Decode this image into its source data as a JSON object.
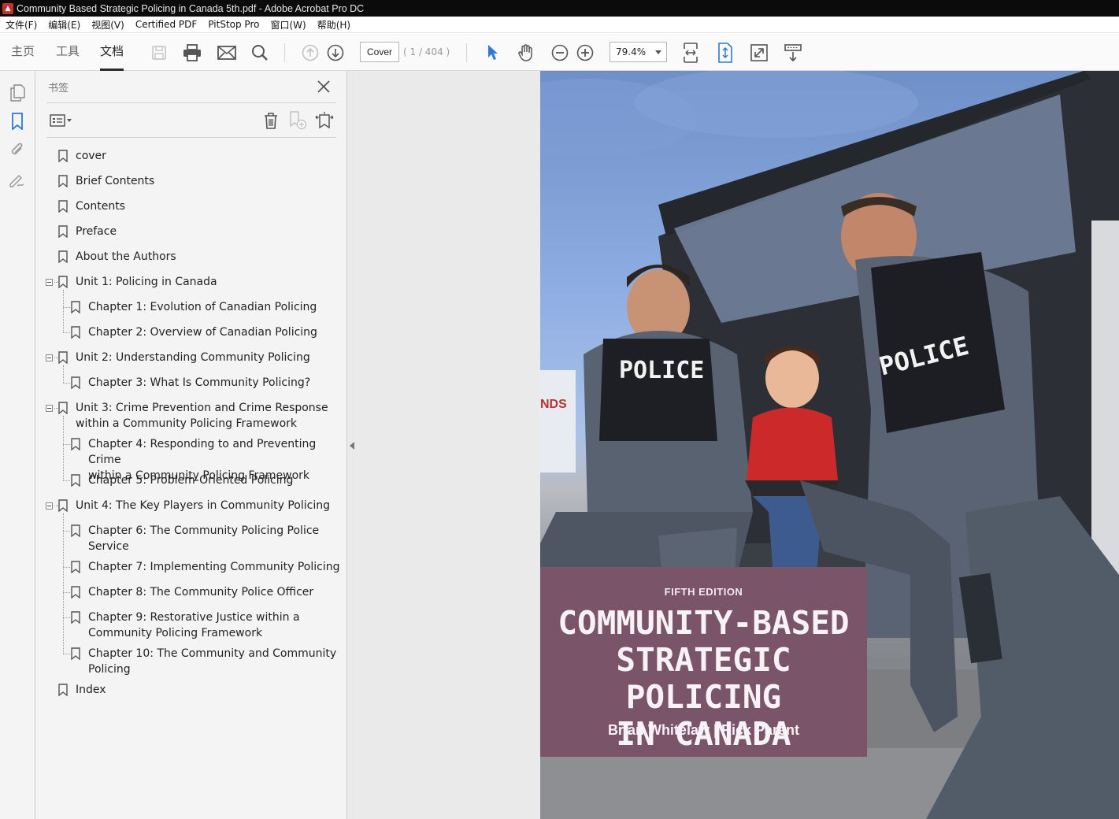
{
  "window": {
    "title": "Community Based Strategic Policing in Canada 5th.pdf - Adobe Acrobat Pro DC",
    "app_icon": "pdf-app-icon"
  },
  "menubar": {
    "items": [
      "文件(F)",
      "编辑(E)",
      "视图(V)",
      "Certified PDF",
      "PitStop Pro",
      "窗口(W)",
      "帮助(H)"
    ]
  },
  "toolbar": {
    "tabs": [
      "主页",
      "工具",
      "文档"
    ],
    "active_tab": "文档",
    "page_field_value": "Cover",
    "page_count": "( 1 / 404 )",
    "zoom_value": "79.4%",
    "icons": [
      "save-icon",
      "print-icon",
      "email-icon",
      "search-icon",
      "prev-page-icon",
      "next-page-icon",
      "select-arrow-icon",
      "hand-icon",
      "zoom-out-icon",
      "zoom-in-icon",
      "fit-width-icon",
      "fit-page-icon",
      "fullscreen-icon",
      "scroll-mode-icon"
    ],
    "accent_color": "#2c7bd6"
  },
  "leftrail": {
    "icons": [
      "page-thumbnails-icon",
      "bookmarks-icon",
      "attachments-icon",
      "signatures-icon"
    ]
  },
  "bookmarks_panel": {
    "title": "书签",
    "items": [
      {
        "label": "cover"
      },
      {
        "label": "Brief Contents"
      },
      {
        "label": "Contents"
      },
      {
        "label": "Preface"
      },
      {
        "label": "About the Authors"
      },
      {
        "label": "Unit 1: Policing in Canada"
      },
      {
        "label": "Chapter 1: Evolution of Canadian Policing"
      },
      {
        "label": "Chapter 2: Overview of Canadian Policing"
      },
      {
        "label": "Unit 2: Understanding Community Policing"
      },
      {
        "label": "Chapter 3: What Is Community Policing?"
      },
      {
        "label": "Unit 3: Crime Prevention and Crime Response",
        "label2": "within a Community Policing Framework"
      },
      {
        "label": "Chapter 4: Responding to and Preventing Crime",
        "label2": "within a Community Policing Framework"
      },
      {
        "label": "Chapter 5: Problem-Oriented Policing"
      },
      {
        "label": "Unit 4: The Key Players in Community Policing"
      },
      {
        "label": "Chapter 6: The Community Policing Police",
        "label2": "Service"
      },
      {
        "label": "Chapter 7: Implementing Community Policing"
      },
      {
        "label": "Chapter 8: The Community Police Officer"
      },
      {
        "label": "Chapter 9: Restorative Justice within a",
        "label2": "Community Policing Framework"
      },
      {
        "label": "Chapter 10: The Community and Community",
        "label2": "Policing"
      },
      {
        "label": "Index"
      }
    ]
  },
  "document": {
    "cover": {
      "edition": "FIFTH EDITION",
      "title_line1": "COMMUNITY-BASED",
      "title_line2": "STRATEGIC POLICING",
      "title_line3": "IN CANADA",
      "authors": "Brian Whitelaw | Rick Parent",
      "vest_text": "POLICE",
      "sign_text": "NDS",
      "band_color": "#7a5468"
    }
  }
}
